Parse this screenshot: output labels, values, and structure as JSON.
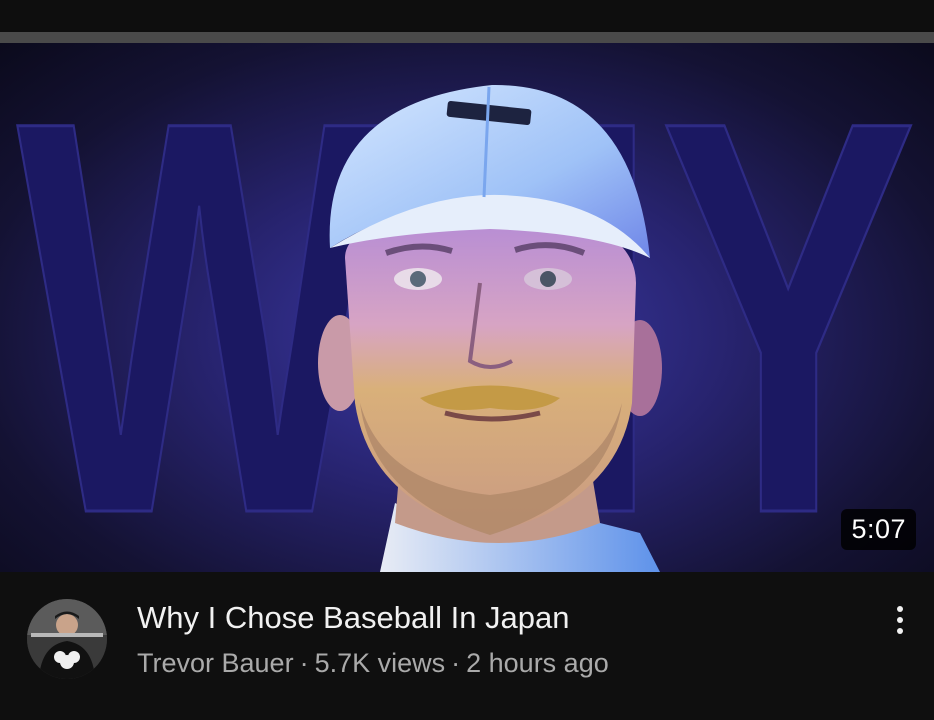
{
  "video": {
    "thumbnail_overlay_text": "WHY",
    "duration": "5:07",
    "title": "Why I Chose Baseball In Japan",
    "channel": "Trevor Bauer",
    "separator": "·",
    "views": "5.7K views",
    "age": "2 hours ago"
  },
  "icons": {
    "more": "more-vertical-icon",
    "avatar": "channel-avatar"
  },
  "colors": {
    "background": "#0f0f0f",
    "title": "#f1f1f1",
    "subtext": "#aaaaaa",
    "thumbnail_accent": "#3c3aa8"
  }
}
